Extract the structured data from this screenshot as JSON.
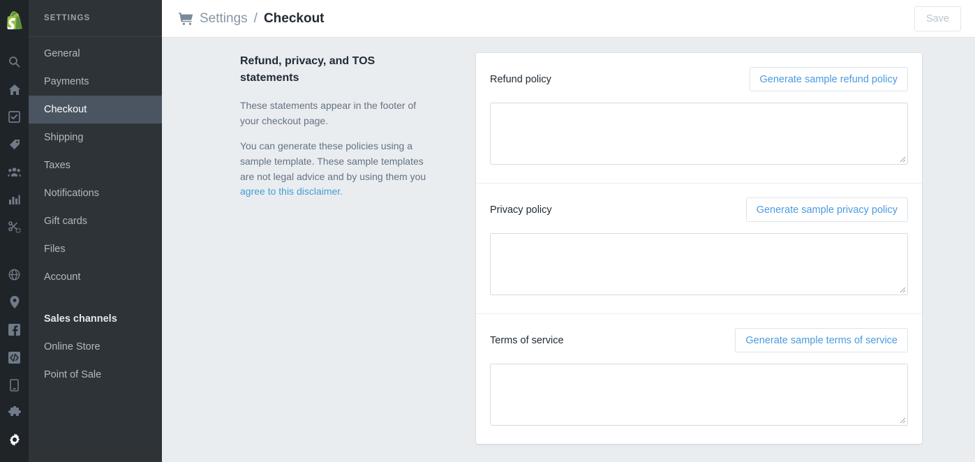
{
  "rail": {
    "logo": "shopify-logo",
    "icons": [
      {
        "name": "search-icon"
      },
      {
        "name": "home-icon"
      },
      {
        "name": "orders-checkbox-icon"
      },
      {
        "name": "products-tag-icon"
      },
      {
        "name": "customers-icon"
      },
      {
        "name": "analytics-bar-chart-icon"
      },
      {
        "name": "discounts-scissors-icon"
      },
      {
        "name": "online-store-globe-icon"
      },
      {
        "name": "location-pin-icon"
      },
      {
        "name": "facebook-icon"
      },
      {
        "name": "code-icon"
      },
      {
        "name": "mobile-point-of-sale-icon"
      },
      {
        "name": "apps-puzzle-icon"
      },
      {
        "name": "settings-gear-icon"
      }
    ]
  },
  "sidebar": {
    "header": "SETTINGS",
    "items": [
      {
        "label": "General",
        "active": false
      },
      {
        "label": "Payments",
        "active": false
      },
      {
        "label": "Checkout",
        "active": true
      },
      {
        "label": "Shipping",
        "active": false
      },
      {
        "label": "Taxes",
        "active": false
      },
      {
        "label": "Notifications",
        "active": false
      },
      {
        "label": "Gift cards",
        "active": false
      },
      {
        "label": "Files",
        "active": false
      },
      {
        "label": "Account",
        "active": false
      }
    ],
    "group_title": "Sales channels",
    "channels": [
      {
        "label": "Online Store"
      },
      {
        "label": "Point of Sale"
      }
    ]
  },
  "topbar": {
    "breadcrumb_parent": "Settings",
    "breadcrumb_separator": "/",
    "breadcrumb_current": "Checkout",
    "save_label": "Save"
  },
  "description": {
    "title": "Refund, privacy, and TOS statements",
    "paragraph_1": "These statements appear in the footer of your checkout page.",
    "paragraph_2_before": "You can generate these policies using a sample template. These sample templates are not legal advice and by using them you ",
    "paragraph_2_link": "agree to this disclaimer.",
    "paragraph_2_after": ""
  },
  "sections": [
    {
      "label": "Refund policy",
      "button_label": "Generate sample refund policy",
      "value": "",
      "placeholder": ""
    },
    {
      "label": "Privacy policy",
      "button_label": "Generate sample privacy policy",
      "value": "",
      "placeholder": ""
    },
    {
      "label": "Terms of service",
      "button_label": "Generate sample terms of service",
      "value": "",
      "placeholder": ""
    }
  ],
  "colors": {
    "rail_bg": "#1f2429",
    "sidebar_bg": "#2e3337",
    "sidebar_active_bg": "#4a5561",
    "page_bg": "#eaedf0",
    "accent_link": "#4a9ae1",
    "brand_green": "#95bf47",
    "text_primary": "#212b36",
    "text_secondary": "#637381"
  }
}
